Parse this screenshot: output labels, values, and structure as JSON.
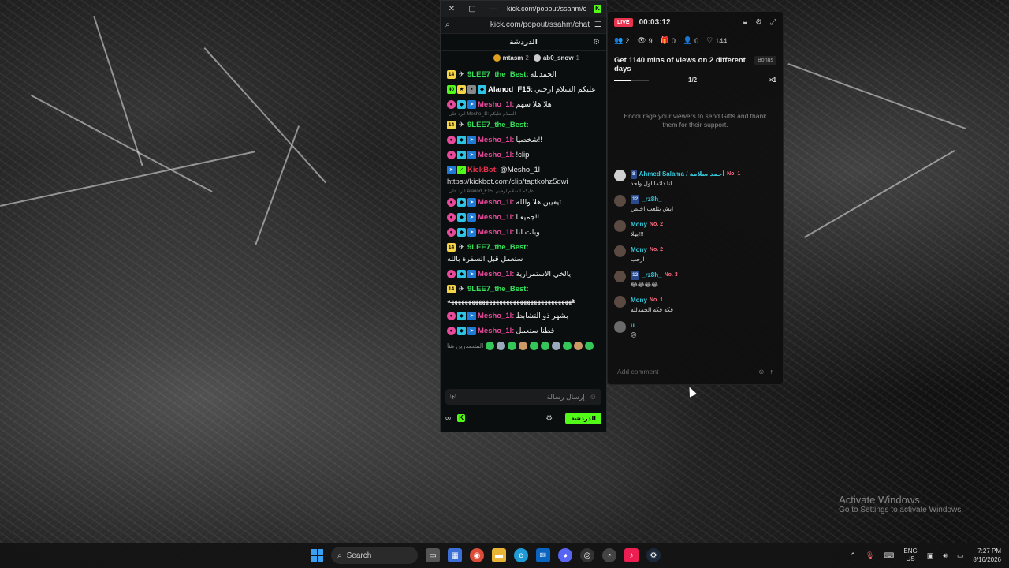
{
  "browser": {
    "close_glyph": "✕",
    "restore_glyph": "▢",
    "minimize_glyph": "—",
    "title": "kick.com/popout/ssahm/ch...",
    "url": "kick.com/popout/ssahm/chat"
  },
  "chat": {
    "header_title": "الدردشة",
    "pinned": [
      {
        "name": "mtasm",
        "count": "2",
        "color": "#e0a020"
      },
      {
        "name": "ab0_snow",
        "count": "1",
        "color": "#cccccc"
      }
    ],
    "messages": [
      {
        "badges": [
          "14",
          "plane"
        ],
        "user": "9LEE7_the_Best:",
        "user_color": "#35e05a",
        "text": "الحمدلله"
      },
      {
        "badges": [
          "40",
          "trophy",
          "gray",
          "cyan"
        ],
        "user": "Alanod_F15:",
        "user_color": "#ffffff",
        "text": "عليكم السلام ارحبي"
      },
      {
        "badges": [
          "pink",
          "cyan",
          "blue"
        ],
        "user": "Mesho_1l:",
        "user_color": "#e84a9b",
        "text": "هلا هلا سهم"
      },
      {
        "reply": "الرد على Mesho_1l: السلام عليكم",
        "badges": [
          "14",
          "plane"
        ],
        "user": "9LEE7_the_Best:",
        "user_color": "#35e05a",
        "text": ""
      },
      {
        "badges": [
          "pink",
          "cyan",
          "blue"
        ],
        "user": "Mesho_1l:",
        "user_color": "#e84a9b",
        "text": "شخصيا!!"
      },
      {
        "badges": [
          "pink",
          "cyan",
          "blue"
        ],
        "user": "Mesho_1l:",
        "user_color": "#e84a9b",
        "text": "!clip"
      },
      {
        "badges": [
          "blue",
          "check"
        ],
        "user": "KickBot:",
        "user_color": "#e8344e",
        "text": "@Mesho_1l",
        "link": "https://kickbot.com/clip/taptkohz5dwi"
      },
      {
        "reply": "الرد على Alanod_F15: عليكم السلام ارحبي",
        "badges": [
          "pink",
          "cyan",
          "blue"
        ],
        "user": "Mesho_1l:",
        "user_color": "#e84a9b",
        "text": "تيفيين هلا والله"
      },
      {
        "badges": [
          "pink",
          "cyan",
          "blue"
        ],
        "user": "Mesho_1l:",
        "user_color": "#e84a9b",
        "text": "جميعاا!!"
      },
      {
        "badges": [
          "pink",
          "cyan",
          "blue"
        ],
        "user": "Mesho_1l:",
        "user_color": "#e84a9b",
        "text": "وبات لنا"
      },
      {
        "badges": [
          "14",
          "plane"
        ],
        "user": "9LEE7_the_Best:",
        "user_color": "#35e05a",
        "text": "ستعمل قبل السفرة بالله"
      },
      {
        "badges": [
          "pink",
          "cyan",
          "blue"
        ],
        "user": "Mesho_1l:",
        "user_color": "#e84a9b",
        "text": "يالخي الاستمرارية"
      },
      {
        "badges": [
          "14",
          "plane"
        ],
        "user": "9LEE7_the_Best:",
        "user_color": "#35e05a",
        "text": "ههههههههههههههههههههههههههههههههههههه"
      },
      {
        "badges": [
          "pink",
          "cyan",
          "blue"
        ],
        "user": "Mesho_1l:",
        "user_color": "#e84a9b",
        "text": "بشهر ذو التشابط"
      },
      {
        "badges": [
          "pink",
          "cyan",
          "blue"
        ],
        "user": "Mesho_1l:",
        "user_color": "#e84a9b",
        "text": "قطنا ستعمل"
      }
    ],
    "emote_label": "المتصدرين هنا",
    "send_placeholder": "إرسال رسالة",
    "chat_button": "الدردشة"
  },
  "live": {
    "badge": "LIVE",
    "timer": "00:03:12",
    "stats": [
      {
        "icon": "people-icon",
        "glyph": "👥",
        "value": "2"
      },
      {
        "icon": "eye-icon",
        "glyph": "👁",
        "value": "9"
      },
      {
        "icon": "gift-icon",
        "glyph": "🎁",
        "value": "0"
      },
      {
        "icon": "follow-icon",
        "glyph": "👤",
        "value": "0"
      },
      {
        "icon": "heart-icon",
        "glyph": "♡",
        "value": "144"
      }
    ],
    "goal_title": "Get 1140 mins of views on 2 different days",
    "bonus": "Bonus",
    "progress_label": "1/2",
    "progress_fraction": 0.5,
    "multiplier": "×1",
    "encourage": "Encourage your viewers to send Gifts and thank them for their support.",
    "feed": [
      {
        "level": "8",
        "name": "Ahmed Salama / أحمد سلامة",
        "rank": "No. 1",
        "text": "انا دائما اول واحد"
      },
      {
        "level": "12",
        "name": "_rz8h_",
        "rank": "",
        "text": "ايش بتلعب اخلص"
      },
      {
        "level": "",
        "name": "Mony",
        "rank": "No. 2",
        "text": "بهلا!!!"
      },
      {
        "level": "",
        "name": "Mony",
        "rank": "No. 2",
        "text": "ارحب"
      },
      {
        "level": "12",
        "name": "_rz8h_",
        "rank": "No. 3",
        "text": "😂😂😂😂"
      },
      {
        "level": "",
        "name": "Mony",
        "rank": "No. 1",
        "text": "فكه فكه الحمدلله"
      },
      {
        "level": "",
        "name": "u",
        "rank": "",
        "text": "😢"
      }
    ],
    "comment_placeholder": "Add comment"
  },
  "watermark": {
    "line1": "Activate Windows",
    "line2": "Go to Settings to activate Windows."
  },
  "taskbar": {
    "search_placeholder": "Search",
    "lang": "ENG",
    "region": "US",
    "time": "7:27 PM",
    "date": "8/16/2026"
  }
}
